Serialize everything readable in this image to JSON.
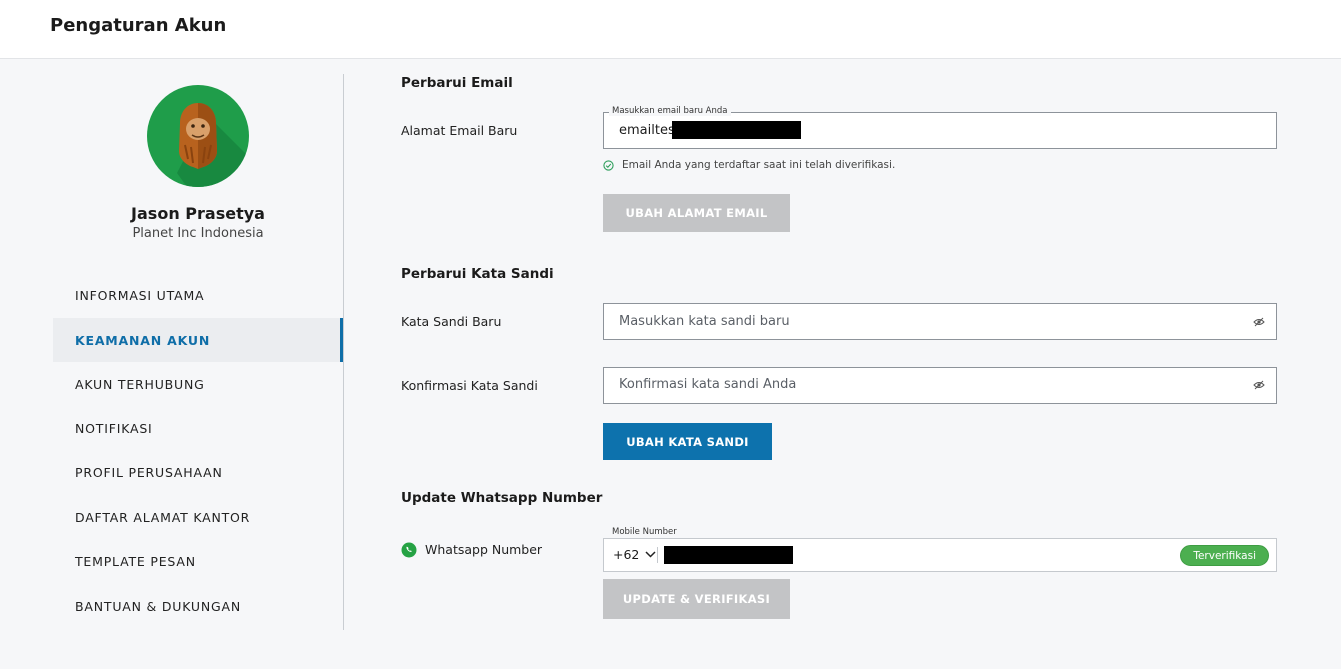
{
  "header": {
    "title": "Pengaturan Akun"
  },
  "profile": {
    "name": "Jason Prasetya",
    "company": "Planet Inc Indonesia"
  },
  "sidebar": {
    "items": [
      {
        "label": "INFORMASI UTAMA",
        "active": false
      },
      {
        "label": "KEAMANAN AKUN",
        "active": true
      },
      {
        "label": "AKUN TERHUBUNG",
        "active": false
      },
      {
        "label": "NOTIFIKASI",
        "active": false
      },
      {
        "label": "PROFIL PERUSAHAAN",
        "active": false
      },
      {
        "label": "DAFTAR ALAMAT KANTOR",
        "active": false
      },
      {
        "label": "TEMPLATE PESAN",
        "active": false
      },
      {
        "label": "BANTUAN & DUKUNGAN",
        "active": false
      }
    ]
  },
  "email_section": {
    "title": "Perbarui Email",
    "field_label": "Alamat Email Baru",
    "floating_label": "Masukkan email baru Anda",
    "value": "emailtest",
    "verified_note": "Email Anda yang terdaftar saat ini telah diverifikasi.",
    "button": "UBAH ALAMAT EMAIL"
  },
  "password_section": {
    "title": "Perbarui Kata Sandi",
    "new_label": "Kata Sandi Baru",
    "new_placeholder": "Masukkan kata sandi baru",
    "confirm_label": "Konfirmasi Kata Sandi",
    "confirm_placeholder": "Konfirmasi kata sandi Anda",
    "button": "UBAH KATA SANDI"
  },
  "whatsapp_section": {
    "title": "Update Whatsapp Number",
    "field_label": "Whatsapp Number",
    "floating_label": "Mobile Number",
    "country_code": "+62",
    "badge": "Terverifikasi",
    "button": "UPDATE & VERIFIKASI"
  },
  "colors": {
    "accent": "#0d72ad",
    "avatar_bg": "#1f9d4a",
    "verified_green": "#4caf50",
    "disabled_button": "#c3c4c6"
  },
  "icons": {
    "avatar": "orangutan-avatar-icon",
    "verified": "check-circle-icon",
    "password_toggle": "eye-slash-icon",
    "country_dropdown": "chevron-down-icon",
    "whatsapp": "whatsapp-icon"
  }
}
